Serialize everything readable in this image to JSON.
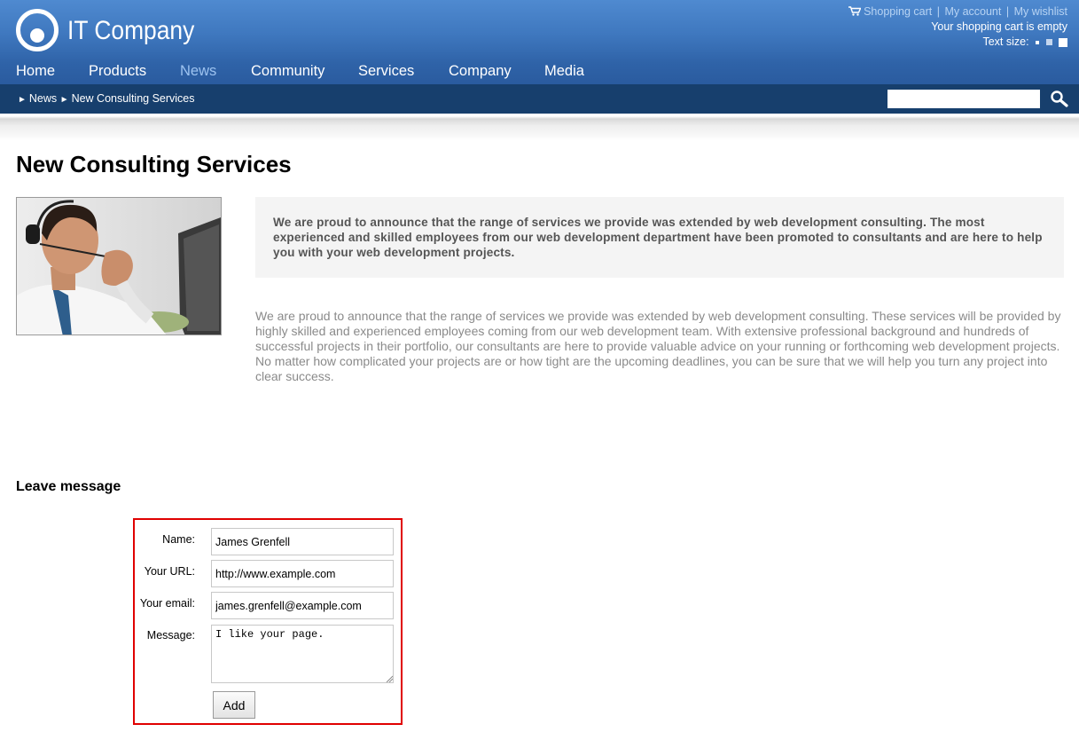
{
  "header": {
    "logo_text": "IT Company",
    "util": {
      "shopping_cart": "Shopping cart",
      "my_account": "My account",
      "my_wishlist": "My wishlist",
      "separator": "|",
      "cart_status": "Your shopping cart is empty",
      "text_size_label": "Text size:"
    },
    "nav": [
      {
        "label": "Home",
        "active": false
      },
      {
        "label": "Products",
        "active": false
      },
      {
        "label": "News",
        "active": true
      },
      {
        "label": "Community",
        "active": false
      },
      {
        "label": "Services",
        "active": false
      },
      {
        "label": "Company",
        "active": false
      },
      {
        "label": "Media",
        "active": false
      }
    ]
  },
  "breadcrumb": {
    "items": [
      "News",
      "New Consulting Services"
    ],
    "search_value": ""
  },
  "article": {
    "title": "New Consulting Services",
    "intro": "We are proud to announce that the range of services we provide was extended by web development consulting. The most experienced and skilled employees from our web development department have been promoted to consultants and are here to help you with your web development projects.",
    "body": "We are proud to announce that the range of services we provide was extended by web development consulting. These services will be provided by highly skilled and experienced employees coming from our web development team. With extensive professional background and hundreds of successful projects in their portfolio, our consultants are here to provide valuable advice on your running or forthcoming web development projects. No matter how complicated your projects are or how tight are the upcoming deadlines, you can be sure that we will help you turn any project into clear success."
  },
  "message_form": {
    "heading": "Leave message",
    "name_label": "Name:",
    "name_value": "James Grenfell",
    "url_label": "Your URL:",
    "url_value": "http://www.example.com",
    "email_label": "Your email:",
    "email_value": "james.grenfell@example.com",
    "message_label": "Message:",
    "message_value": "I like your page.",
    "add_label": "Add"
  },
  "colors": {
    "header_blue": "#3f78bf",
    "crumb_bar": "#173f6d",
    "active_nav": "#9dc3f0",
    "highlight_border": "#e00000"
  },
  "icons": {
    "cart": "cart-icon",
    "search": "magnifier-icon",
    "logo": "ring-logo"
  }
}
